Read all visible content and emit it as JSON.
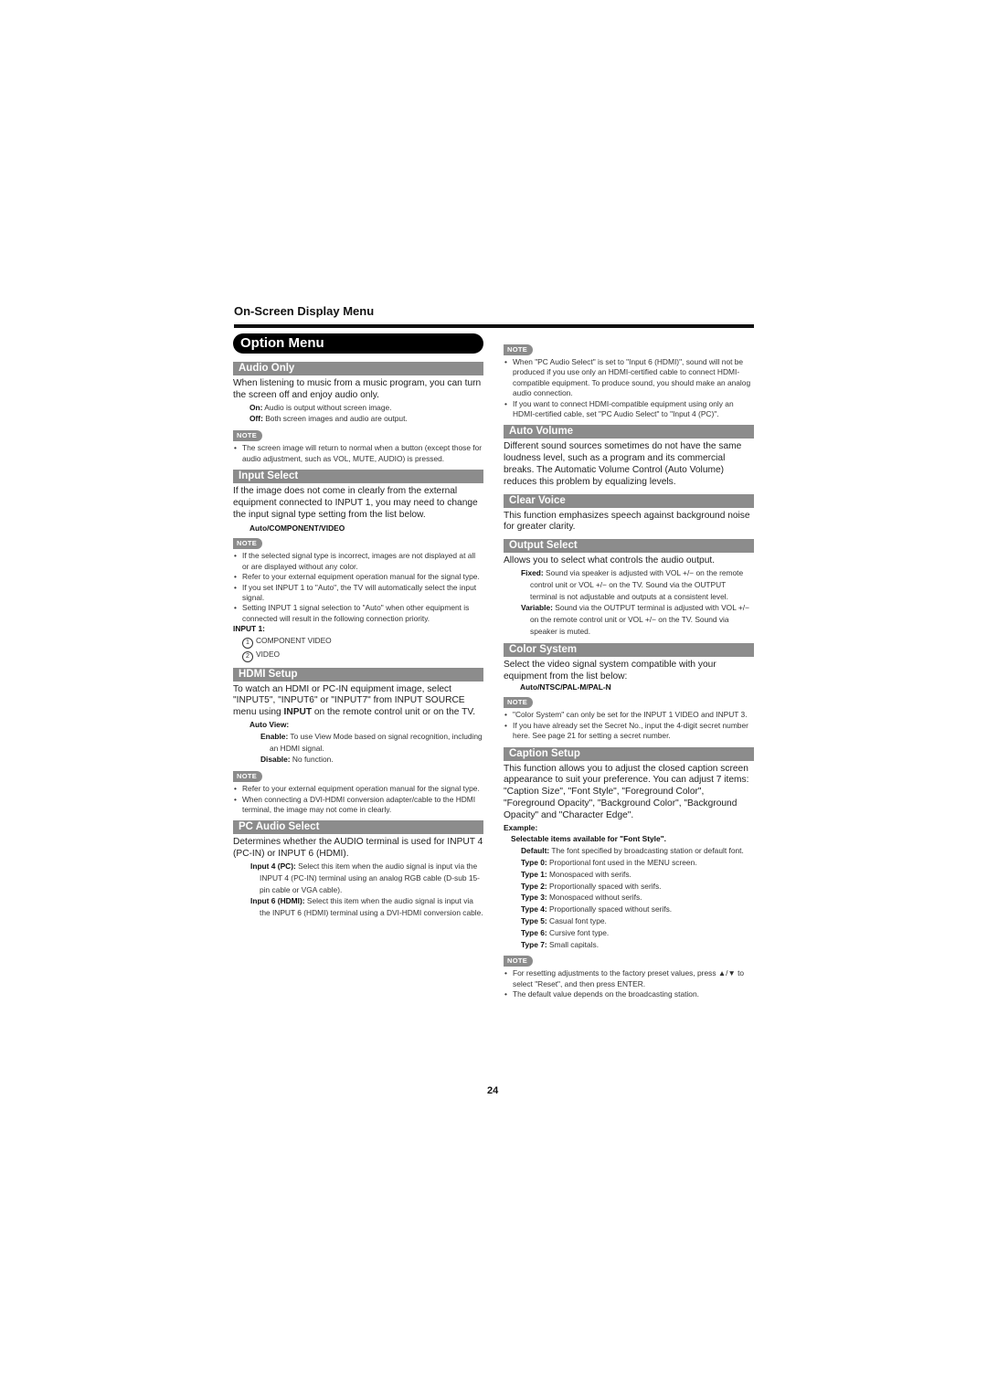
{
  "header": {
    "section": "On-Screen Display Menu",
    "page_number": "24"
  },
  "title": "Option Menu",
  "note_label": "NOTE",
  "left": {
    "audio_only": {
      "heading": "Audio Only",
      "body": "When listening to music from a music program, you can turn the screen off and enjoy audio only.",
      "options": [
        {
          "label": "On:",
          "text": " Audio is output without screen image."
        },
        {
          "label": "Off:",
          "text": " Both screen images and audio are output."
        }
      ],
      "notes": [
        "The screen image will return to normal when a button (except those for audio adjustment, such as VOL, MUTE, AUDIO) is pressed."
      ]
    },
    "input_select": {
      "heading": "Input Select",
      "body": "If the image does not come in clearly from the external equipment connected to INPUT 1, you may need to change the input signal type setting from the list below.",
      "choices": "Auto/COMPONENT/VIDEO",
      "notes": [
        "If the selected signal type is incorrect, images are not displayed at all or are displayed without any color.",
        "Refer to your external equipment operation manual for the signal type.",
        "If you set INPUT 1 to \"Auto\", the TV will automatically select the input signal.",
        "Setting INPUT 1 signal selection to \"Auto\" when other equipment is connected will result in the following connection priority."
      ],
      "priority_label": "INPUT 1:",
      "priority": [
        {
          "num": "1",
          "text": "COMPONENT VIDEO"
        },
        {
          "num": "2",
          "text": "VIDEO"
        }
      ]
    },
    "hdmi_setup": {
      "heading": "HDMI Setup",
      "body_pre": "To watch an HDMI or PC-IN equipment image, select \"INPUT5\", \"INPUT6\" or \"INPUT7\" from INPUT SOURCE menu using ",
      "body_bold": "INPUT",
      "body_post": " on the remote control unit or on the TV.",
      "auto_view_label": "Auto View:",
      "options": [
        {
          "label": "Enable:",
          "text": " To use View Mode based on signal recognition, including an HDMI signal."
        },
        {
          "label": "Disable:",
          "text": " No function."
        }
      ],
      "notes": [
        "Refer to your external equipment operation manual for the signal type.",
        "When connecting a DVI-HDMI conversion adapter/cable to the HDMI terminal, the image may not come in clearly."
      ]
    },
    "pc_audio_select": {
      "heading": "PC Audio Select",
      "body": "Determines whether the AUDIO terminal is used for INPUT 4 (PC-IN) or INPUT 6 (HDMI).",
      "options": [
        {
          "label": "Input 4 (PC):",
          "text": " Select this item when the audio signal is input via the INPUT 4 (PC-IN) terminal using an analog RGB cable (D-sub 15-pin cable or VGA cable)."
        },
        {
          "label": "Input 6 (HDMI):",
          "text": " Select this item when the audio signal is input via the INPUT 6 (HDMI) terminal using a DVI-HDMI conversion cable."
        }
      ]
    }
  },
  "right": {
    "pc_audio_notes": [
      "When \"PC Audio Select\" is set to \"Input 6 (HDMI)\", sound will not be produced if you use only an HDMI-certified cable to connect HDMI-compatible equipment. To produce sound, you should make an analog audio connection.",
      "If you want to connect HDMI-compatible equipment using only an HDMI-certified cable, set \"PC Audio Select\" to \"Input 4 (PC)\"."
    ],
    "auto_volume": {
      "heading": "Auto Volume",
      "body": "Different sound sources sometimes do not have the same loudness level, such as a program and its commercial breaks. The Automatic Volume Control (Auto Volume) reduces this problem by equalizing levels."
    },
    "clear_voice": {
      "heading": "Clear Voice",
      "body": "This function emphasizes speech against background noise for greater clarity."
    },
    "output_select": {
      "heading": "Output Select",
      "body": "Allows you to select what controls the audio output.",
      "fixed_label": "Fixed:",
      "fixed_text": " Sound via speaker is adjusted with VOL +/− on the remote control unit or VOL +/− on the TV. Sound via the OUTPUT terminal is not adjustable and outputs at a consistent level.",
      "variable_label": "Variable:",
      "variable_text": " Sound via the OUTPUT terminal is adjusted with VOL +/− on the remote control unit or VOL +/− on the TV. Sound via speaker is muted."
    },
    "color_system": {
      "heading": "Color System",
      "body": "Select the video signal system compatible with your equipment from the list below:",
      "choices": "Auto/NTSC/PAL-M/PAL-N",
      "notes": [
        "\"Color System\" can only be set for the INPUT 1 VIDEO and INPUT 3.",
        "If you have already set the Secret No., input the 4-digit secret number here. See page 21 for setting a secret number."
      ]
    },
    "caption_setup": {
      "heading": "Caption Setup",
      "body": "This function allows you to adjust the closed caption screen appearance to suit your preference. You can adjust 7 items: \"Caption Size\", \"Font Style\", \"Foreground Color\", \"Foreground Opacity\", \"Background Color\", \"Background Opacity\" and \"Character Edge\".",
      "example_label": "Example:",
      "font_style_label": "Selectable items available for \"Font Style\".",
      "font_styles": [
        {
          "label": "Default:",
          "text": " The font specified by broadcasting station or default font."
        },
        {
          "label": "Type 0:",
          "text": " Proportional font used in the MENU screen."
        },
        {
          "label": "Type 1:",
          "text": " Monospaced with serifs."
        },
        {
          "label": "Type 2:",
          "text": " Proportionally spaced with serifs."
        },
        {
          "label": "Type 3:",
          "text": " Monospaced without serifs."
        },
        {
          "label": "Type 4:",
          "text": " Proportionally spaced without serifs."
        },
        {
          "label": "Type 5:",
          "text": " Casual font type."
        },
        {
          "label": "Type 6:",
          "text": " Cursive font type."
        },
        {
          "label": "Type 7:",
          "text": " Small capitals."
        }
      ],
      "notes": [
        "For resetting adjustments to the factory preset values, press ▲/▼ to select \"Reset\", and then press ENTER.",
        "The default value depends on the broadcasting station."
      ]
    }
  }
}
